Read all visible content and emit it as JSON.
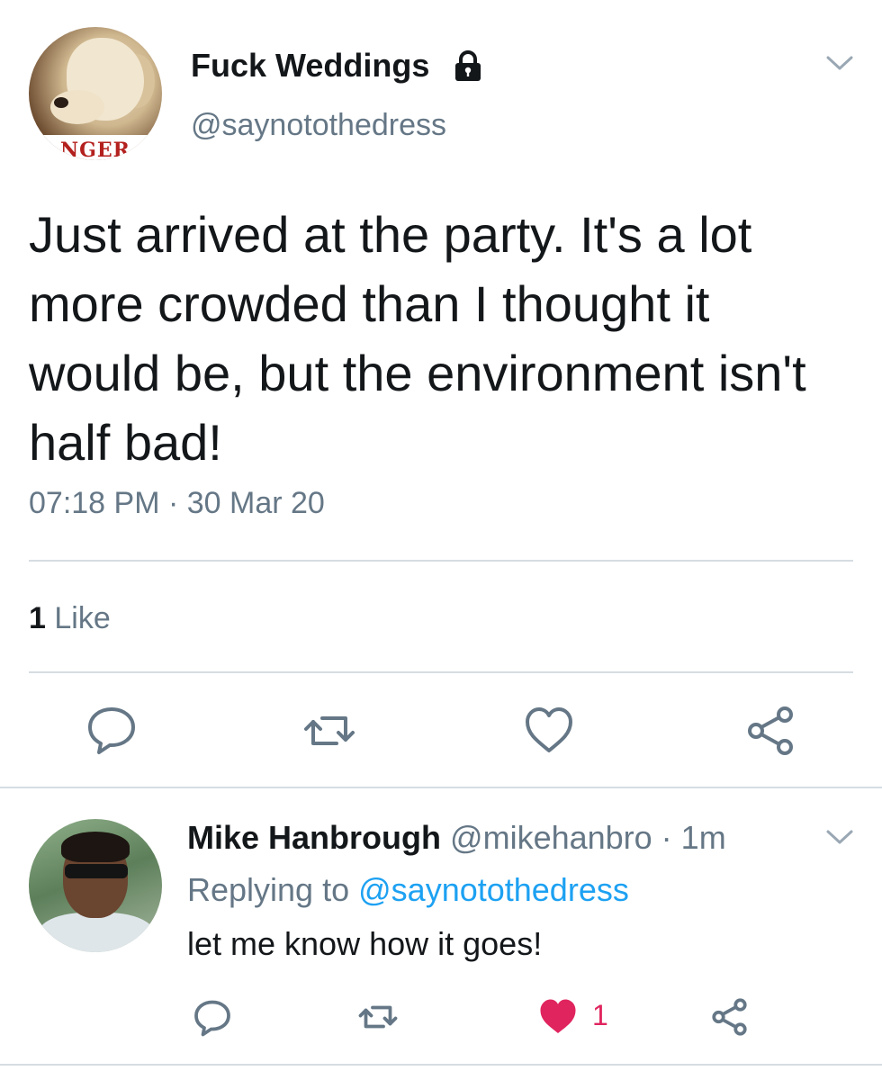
{
  "tweet": {
    "display_name": "Fuck Weddings",
    "handle": "@saynotothedress",
    "avatar_banner_text": "NGER",
    "text": "Just arrived at the party. It's a lot more crowded than I thought it would be, but the environment isn't half bad!",
    "timestamp": "07:18 PM · 30 Mar 20",
    "like_count": "1",
    "like_label": "Like",
    "icons": [
      "lock-icon",
      "chevron-down-icon",
      "reply-icon",
      "retweet-icon",
      "like-icon",
      "share-icon"
    ]
  },
  "reply": {
    "display_name": "Mike Hanbrough",
    "meta": "@mikehanbro · 1m",
    "replying_prefix": "Replying to",
    "replying_mention": "@saynotothedress",
    "text": "let me know how it goes!",
    "like_count": "1",
    "icons": [
      "chevron-down-icon",
      "reply-icon",
      "retweet-icon",
      "heart-filled-icon",
      "share-icon"
    ]
  },
  "colors": {
    "text": "#14171a",
    "muted": "#657786",
    "link": "#1da1f2",
    "like": "#e0245e",
    "divider": "#d6dde3"
  }
}
